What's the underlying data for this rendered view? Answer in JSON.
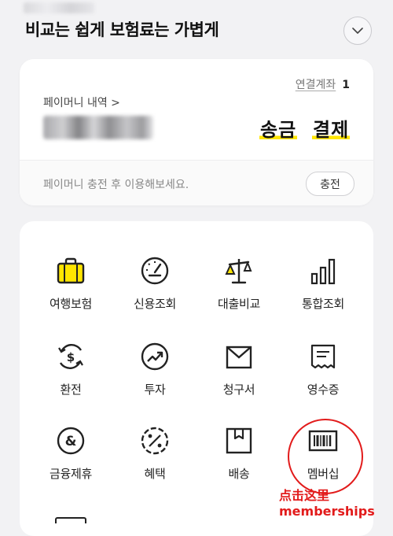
{
  "header": {
    "headline": "비교는 쉽게 보험료는 가볍게"
  },
  "pay_card": {
    "linked_account_label": "연결계좌",
    "linked_account_count": "1",
    "history_link": "페이머니 내역 >",
    "send_label": "송금",
    "pay_label": "결제",
    "charge_hint": "페이머니 충전 후 이용해보세요.",
    "charge_button": "충전"
  },
  "services": [
    {
      "label": "여행보험",
      "icon": "suitcase-icon"
    },
    {
      "label": "신용조회",
      "icon": "gauge-icon"
    },
    {
      "label": "대출비교",
      "icon": "scale-icon"
    },
    {
      "label": "통합조회",
      "icon": "bar-chart-icon"
    },
    {
      "label": "환전",
      "icon": "dollar-exchange-icon"
    },
    {
      "label": "투자",
      "icon": "trend-up-icon"
    },
    {
      "label": "청구서",
      "icon": "envelope-icon"
    },
    {
      "label": "영수증",
      "icon": "receipt-icon"
    },
    {
      "label": "금융제휴",
      "icon": "ampersand-icon"
    },
    {
      "label": "혜택",
      "icon": "percent-badge-icon"
    },
    {
      "label": "배송",
      "icon": "box-icon"
    },
    {
      "label": "멤버십",
      "icon": "barcode-card-icon"
    }
  ],
  "annotation": {
    "line1": "点击这里",
    "line2": "memberships"
  },
  "colors": {
    "accent_yellow": "#ffe600",
    "annotation_red": "#e21b1b",
    "background": "#f2f2f4"
  }
}
